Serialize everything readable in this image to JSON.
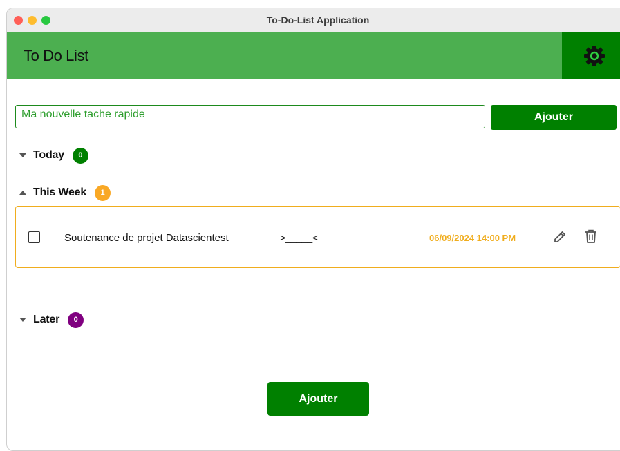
{
  "window": {
    "title": "To-Do-List Application"
  },
  "header": {
    "title": "To Do List",
    "settings_icon": "gear-icon"
  },
  "quick_add": {
    "value": "Ma nouvelle tache rapide",
    "button_label": "Ajouter"
  },
  "sections": {
    "today": {
      "label": "Today",
      "count": "0",
      "color": "#008000",
      "expanded": false
    },
    "this_week": {
      "label": "This Week",
      "count": "1",
      "color": "#f9a825",
      "expanded": true
    },
    "later": {
      "label": "Later",
      "count": "0",
      "color": "#800080",
      "expanded": false
    }
  },
  "tasks": [
    {
      "checked": false,
      "title": "Soutenance de projet Datascientest",
      "note": ">_____<",
      "due": "06/09/2024 14:00 PM",
      "due_color": "#f0ad1e",
      "edit_icon": "pencil-icon",
      "delete_icon": "trash-icon"
    }
  ],
  "footer": {
    "add_button_label": "Ajouter"
  },
  "colors": {
    "header_green": "#4caf50",
    "accent_green": "#008000",
    "week_orange": "#f0ad1e"
  }
}
